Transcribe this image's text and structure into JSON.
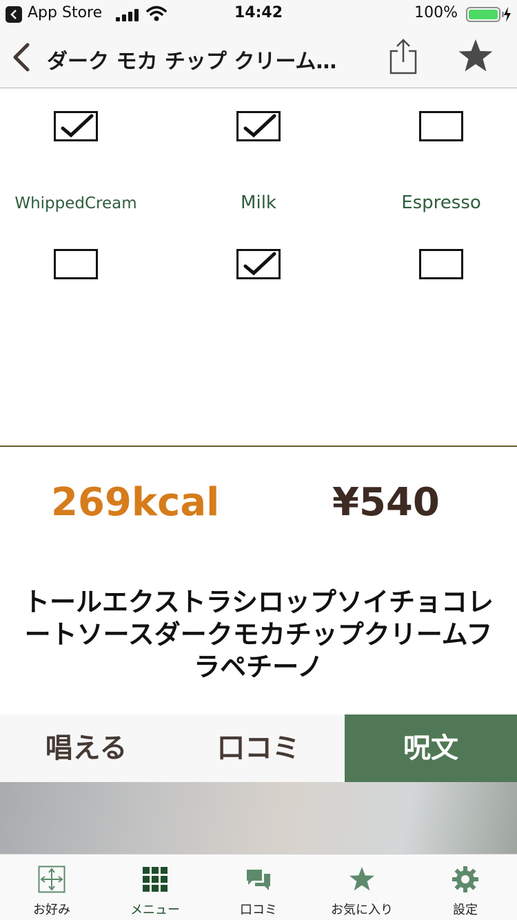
{
  "status_bar": {
    "back_app": "App Store",
    "time": "14:42",
    "battery": "100%"
  },
  "nav": {
    "title": "ダーク モカ チップ クリーム…"
  },
  "options": {
    "top_row": [
      {
        "name": "option-1",
        "checked": true
      },
      {
        "name": "option-2",
        "checked": true
      },
      {
        "name": "option-3",
        "checked": false
      }
    ],
    "labels": [
      "WhippedCream",
      "Milk",
      "Espresso"
    ],
    "bottom_row": [
      {
        "name": "whipped-cream",
        "checked": false
      },
      {
        "name": "milk",
        "checked": true
      },
      {
        "name": "espresso",
        "checked": false
      }
    ]
  },
  "summary": {
    "calories": "269kcal",
    "price": "¥540"
  },
  "drink": {
    "name": "トールエクストラシロップソイチョコレートソースダークモカチップクリームフラペチーノ"
  },
  "tabs": [
    {
      "label": "唱える",
      "active": false
    },
    {
      "label": "口コミ",
      "active": false
    },
    {
      "label": "呪文",
      "active": true
    }
  ],
  "tab_bar": [
    {
      "label": "お好み",
      "icon": "compass-arrows-icon",
      "active": false
    },
    {
      "label": "メニュー",
      "icon": "grid-icon",
      "active": true
    },
    {
      "label": "口コミ",
      "icon": "chat-bubbles-icon",
      "active": false
    },
    {
      "label": "お気に入り",
      "icon": "star-icon",
      "active": false
    },
    {
      "label": "設定",
      "icon": "gear-icon",
      "active": false
    }
  ],
  "colors": {
    "accent_green": "#517856",
    "calorie_orange": "#d67c1c",
    "price_brown": "#3d2a22",
    "label_green": "#2f5e3c"
  }
}
